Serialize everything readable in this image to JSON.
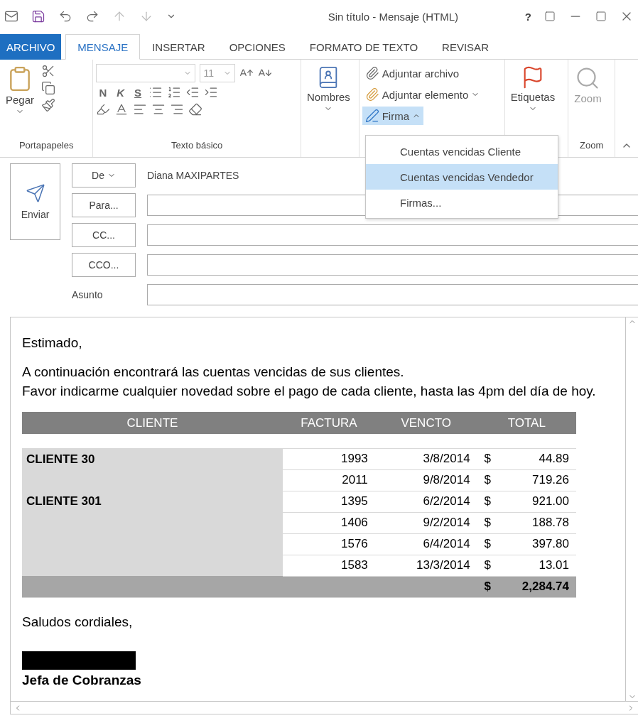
{
  "title_bar": {
    "title": "Sin título - Mensaje (HTML)",
    "help": "?"
  },
  "tabs": [
    {
      "label": "ARCHIVO",
      "kind": "file",
      "selected": false
    },
    {
      "label": "MENSAJE",
      "kind": "tab",
      "selected": true
    },
    {
      "label": "INSERTAR",
      "kind": "tab",
      "selected": false
    },
    {
      "label": "OPCIONES",
      "kind": "tab",
      "selected": false
    },
    {
      "label": "FORMATO DE TEXTO",
      "kind": "tab",
      "selected": false
    },
    {
      "label": "REVISAR",
      "kind": "tab",
      "selected": false
    }
  ],
  "ribbon": {
    "clipboard": {
      "paste": "Pegar",
      "group_label": "Portapapeles"
    },
    "basic_text": {
      "font_size": "11",
      "bold": "N",
      "italic": "K",
      "underline": "S",
      "group_label": "Texto básico"
    },
    "names": {
      "label": "Nombres"
    },
    "include": {
      "attach_file": "Adjuntar archivo",
      "attach_item": "Adjuntar elemento",
      "signature": {
        "label": "Firma",
        "expanded": true
      }
    },
    "tags": {
      "label": "Etiquetas"
    },
    "zoom": {
      "label": "Zoom",
      "disabled": true,
      "group_label": "Zoom"
    }
  },
  "signature_menu": [
    {
      "label": "Cuentas vencidas Cliente",
      "selected": false
    },
    {
      "label": "Cuentas vencidas Vendedor",
      "selected": true
    },
    {
      "label": "Firmas...",
      "selected": false
    }
  ],
  "compose": {
    "send": "Enviar",
    "from_button": "De",
    "from_value": "Diana MAXIPARTES",
    "fields": [
      {
        "kind": "button",
        "label": "Para..."
      },
      {
        "kind": "button",
        "label": "CC..."
      },
      {
        "kind": "button",
        "label": "CCO..."
      },
      {
        "kind": "label",
        "label": "Asunto"
      }
    ]
  },
  "body": {
    "greeting": "Estimado,",
    "lines": [
      "A continuación encontrará las cuentas vencidas de sus clientes.",
      "Favor indicarme cualquier novedad sobre el pago de cada cliente, hasta las 4pm del día de hoy."
    ],
    "table": {
      "columns": [
        "CLIENTE",
        "FACTURA",
        "VENCTO",
        "TOTAL"
      ],
      "groups": [
        {
          "client": "CLIENTE 30",
          "rows": [
            {
              "factura": "1993",
              "vencto": "3/8/2014",
              "currency": "$",
              "total": "44.89"
            },
            {
              "factura": "2011",
              "vencto": "9/8/2014",
              "currency": "$",
              "total": "719.26"
            }
          ]
        },
        {
          "client": "CLIENTE 301",
          "rows": [
            {
              "factura": "1395",
              "vencto": "6/2/2014",
              "currency": "$",
              "total": "921.00"
            },
            {
              "factura": "1406",
              "vencto": "9/2/2014",
              "currency": "$",
              "total": "188.78"
            },
            {
              "factura": "1576",
              "vencto": "6/4/2014",
              "currency": "$",
              "total": "397.80"
            },
            {
              "factura": "1583",
              "vencto": "13/3/2014",
              "currency": "$",
              "total": "13.01"
            }
          ]
        }
      ],
      "grand_total": {
        "currency": "$",
        "total": "2,284.74"
      }
    },
    "closing": "Saludos cordiales,",
    "signature_title": "Jefa de Cobranzas"
  }
}
